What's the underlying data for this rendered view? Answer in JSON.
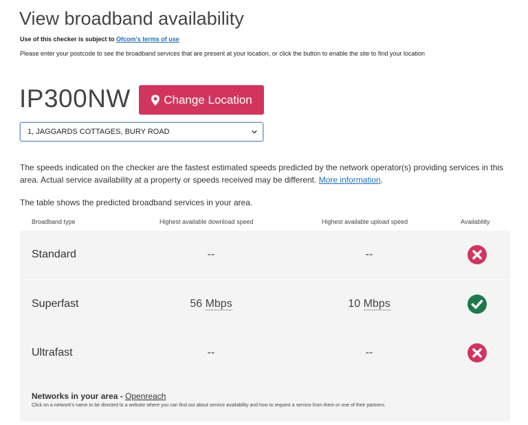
{
  "header": {
    "title": "View broadband availability",
    "terms_prefix": "Use of this checker is subject to ",
    "terms_link": "Ofcom's terms of use",
    "instructions": "Please enter your postcode to see the broadband services that are present at your location, or click the button to enable the site to find your location"
  },
  "location": {
    "postcode": "IP300NW",
    "change_button": "Change Location",
    "selected_address": "1, JAGGARDS COTTAGES, BURY ROAD"
  },
  "info": {
    "disclaimer": "The speeds indicated on the checker are the fastest estimated speeds predicted by the network operator(s) providing services in this area. Actual service availability at a property or speeds received may be different. ",
    "more_link": "More information",
    "table_intro": "The table shows the predicted broadband services in your area."
  },
  "table": {
    "headers": [
      "Broadband type",
      "Highest available download speed",
      "Highest available upload speed",
      "Availability"
    ],
    "rows": [
      {
        "type": "Standard",
        "download": "--",
        "download_unit": "",
        "upload": "--",
        "upload_unit": "",
        "available": false
      },
      {
        "type": "Superfast",
        "download": "56",
        "download_unit": "Mbps",
        "upload": "10",
        "upload_unit": "Mbps",
        "available": true
      },
      {
        "type": "Ultrafast",
        "download": "--",
        "download_unit": "",
        "upload": "--",
        "upload_unit": "",
        "available": false
      }
    ]
  },
  "networks": {
    "label": "Networks in your area - ",
    "provider": "Openreach",
    "note": "Click on a network's name to be directed to a website where you can find out about service availability and how to request a service from them or one of their partners."
  },
  "colors": {
    "brand": "#d1355d",
    "available": "#1e7a4c",
    "unavailable": "#d1355d",
    "link": "#1f6fb8"
  }
}
